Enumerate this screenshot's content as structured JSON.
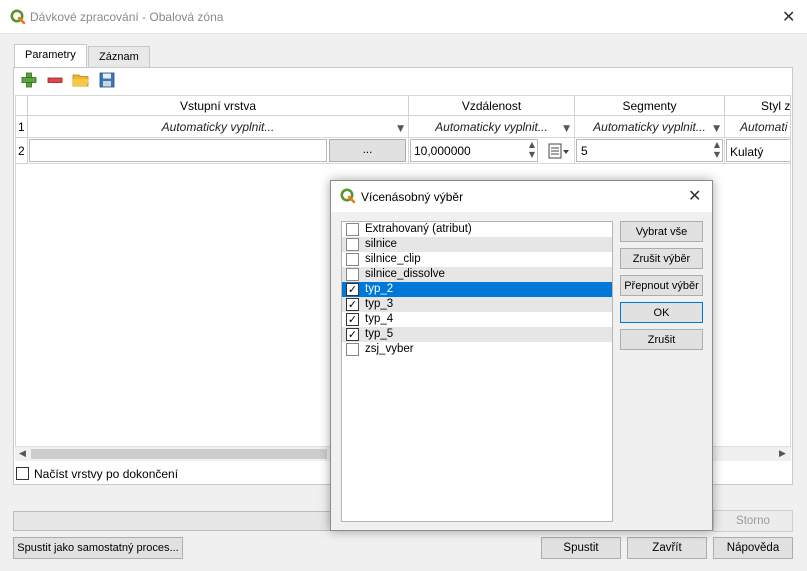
{
  "window": {
    "title": "Dávkové zpracování - Obalová zóna"
  },
  "tabs": [
    "Parametry",
    "Záznam"
  ],
  "toolbar": {
    "add": "add-row-icon",
    "remove": "remove-row-icon",
    "open": "folder-open-icon",
    "save": "save-icon"
  },
  "grid": {
    "columns": [
      "Vstupní vrstva",
      "Vzdálenost",
      "Segmenty",
      "Styl za"
    ],
    "row1": {
      "num": "1",
      "auto1": "Automaticky vyplnit...",
      "auto2": "Automaticky vyplnit...",
      "auto3": "Automaticky vyplnit...",
      "auto4": "Automati"
    },
    "row2": {
      "num": "2",
      "browse": "...",
      "distance": "10,000000",
      "segments": "5",
      "style": "Kulatý"
    }
  },
  "load_layers": "Načíst vrstvy po dokončení",
  "bottom": {
    "cancel": "Storno",
    "standalone": "Spustit jako samostatný proces...",
    "run": "Spustit",
    "close": "Zavřít",
    "help": "Nápověda"
  },
  "dialog": {
    "title": "Vícenásobný výběr",
    "items": [
      {
        "label": "Extrahovaný (atribut)",
        "checked": false,
        "selected": false
      },
      {
        "label": "silnice",
        "checked": false,
        "selected": false
      },
      {
        "label": "silnice_clip",
        "checked": false,
        "selected": false
      },
      {
        "label": "silnice_dissolve",
        "checked": false,
        "selected": false
      },
      {
        "label": "typ_2",
        "checked": true,
        "selected": true
      },
      {
        "label": "typ_3",
        "checked": true,
        "selected": false
      },
      {
        "label": "typ_4",
        "checked": true,
        "selected": false
      },
      {
        "label": "typ_5",
        "checked": true,
        "selected": false
      },
      {
        "label": "zsj_vyber",
        "checked": false,
        "selected": false
      }
    ],
    "buttons": {
      "select_all": "Vybrat vše",
      "clear": "Zrušit výběr",
      "toggle": "Přepnout výběr",
      "ok": "OK",
      "cancel": "Zrušit"
    }
  },
  "colors": {
    "selection": "#0078d7",
    "qgis_green": "#589632"
  }
}
